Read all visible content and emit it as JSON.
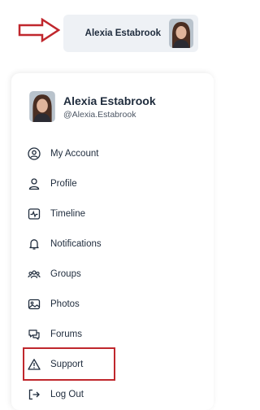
{
  "header": {
    "user_name": "Alexia Estabrook",
    "arrow_color": "#c0272d"
  },
  "profile": {
    "name": "Alexia Estabrook",
    "handle": "@Alexia.Estabrook"
  },
  "menu": {
    "items": [
      {
        "label": "My Account",
        "icon": "account-circle-icon"
      },
      {
        "label": "Profile",
        "icon": "user-icon"
      },
      {
        "label": "Timeline",
        "icon": "timeline-icon"
      },
      {
        "label": "Notifications",
        "icon": "bell-icon"
      },
      {
        "label": "Groups",
        "icon": "groups-icon"
      },
      {
        "label": "Photos",
        "icon": "photos-icon"
      },
      {
        "label": "Forums",
        "icon": "forums-icon"
      },
      {
        "label": "Support",
        "icon": "warning-icon",
        "highlighted": true
      },
      {
        "label": "Log Out",
        "icon": "logout-icon"
      }
    ]
  },
  "colors": {
    "highlight": "#c0272d",
    "text": "#1e2b3c",
    "pill_bg": "#eef1f5"
  }
}
